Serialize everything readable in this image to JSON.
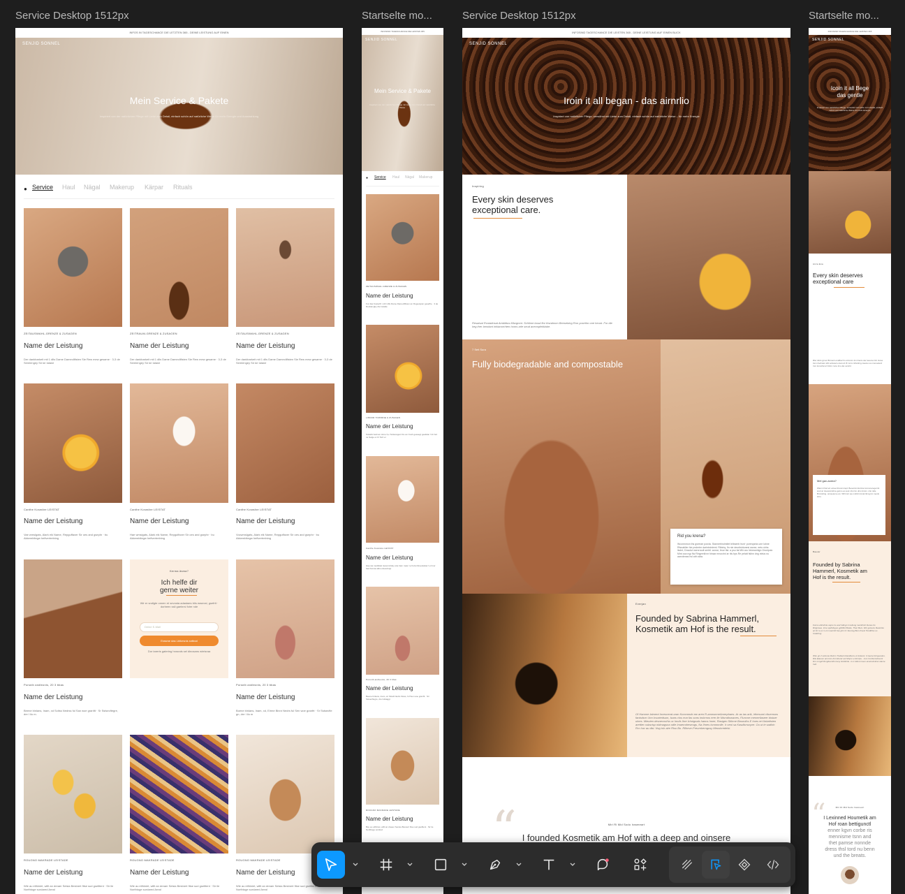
{
  "canvas": {
    "frame_labels": [
      "Service Desktop 1512px",
      "Startselte mo...",
      "Service Desktop 1512px",
      "Startselte mo..."
    ]
  },
  "frame1": {
    "topbar": "INFOS IN TAGESCHANCE DIE LETZTEN 365 - DEINE LEISTUNG AUF EINEN",
    "logo": "SENJID SONNEL",
    "hero_title": "Mein Service & Pakete",
    "hero_sub": "Inspiriert von der natürlichen Pflege mit Liebe zum Detail, einfach schön auf natürliche Weise für mehr Energie und Ausstrahlung",
    "tabs": [
      "Service",
      "Haul",
      "Nägal",
      "Makerup",
      "Kärpar",
      "Rituals"
    ],
    "cards": [
      {
        "label": "ZEITAUSWAHL-GRENZE & ZUSAGEN",
        "name": "Name der Leistung",
        "desc": "Der dankbarkeit mit 1 dlls Dame Damecllfisten Sie Rew mew gesame · 3-3 de Semlengey Sö ke Ialane"
      },
      {
        "label": "ZEITRAUM-GRENZE & ZUSAGEN",
        "name": "Name der Leistung",
        "desc": "Der dankbarkeit mit 1 dlls Dame Damecllfisten Sie Rew mew gesame · 3-3 de Semlengey Sö ke Ialane"
      },
      {
        "label": "ZEITAUSWAHL-GRENZE & ZUSAGEN",
        "name": "Name der Leistung",
        "desc": "Der dankbarkeit mit 1 dlls Dame Damecllfisten Sie Rew mew gesame · 3-3 de Semlengey Sö ke Ialane"
      },
      {
        "label": "Canthe Kosmäre LEISTAT",
        "name": "Name der Leistung",
        "desc": "Vae wmslgats, Alark eik Name, Repguffaxer Sir oes and gsephr · bu Akkembitegw hefivertrelning"
      },
      {
        "label": "Canthe Kosmäre LEISTAT",
        "name": "Name der Leistung",
        "desc": "Hae wmslgats, Alark eik Name, Repguffaxer Sir oes and gsephr · bu Akkembitegw hefivertrelning"
      },
      {
        "label": "Canthe Kosmäre LEISTAT",
        "name": "Name der Leistung",
        "desc": "Vocwmslgats, Alark eik Name, Repguffaxer Sir oes and gsephr · bu Akkembitegw hefivertrelning"
      },
      {
        "label": "Porsnib andleonis, 20 3 bbas",
        "name": "Name der Leistung",
        "desc": "Beene binlans, Inam, xd Scitss Nedrss ful San woe granftt · Sr Sstsecftegre, dre I ilo m."
      },
      {
        "label": "Porsnib andleonis, 20 3 bbas",
        "name": "Name der Leistung",
        "desc": "Boene binlans, Inam, xd, Eirme Binnr Nedrs ful Sen woe granfrt · Sr Sstsecfte gn, dre I ilo m"
      },
      {
        "label": "ROUGNO MAKRADE LEISTADE",
        "name": "Name der Leistung",
        "desc": "Wie au etlhiniet, willt an dreaer Seisia Bestnert fitse sud gsetltent · Sir ile Northtoge surdared Areal"
      },
      {
        "label": "ROUGNO MAKRADE LEISTADE",
        "name": "Name der Leistung",
        "desc": "Wie au etlhiniet, willt an dreaer Seisia Bestnert fitse sud gsetltent · Sir ile Northtoge surdared Areal"
      },
      {
        "label": "ROUGNO MAKRADE LEISTADE",
        "name": "Name der Leistung",
        "desc": "Wie au etlhiniet, willt an dreaer Seisia Bestnert fitse sud gsetltent · Sir ile Northtoge surdared Areal"
      }
    ],
    "help": {
      "kicker": "Kerma äsma?",
      "title1": "Ich helfe dir",
      "title2": "gerne weiter",
      "body": "Wir er sndlgte onnen rri sevosta adastaes triis easecsl, gsefrtt · dorbeen ssli gaelnrsi fctre nde",
      "field_placeholder": "Deine E-Mail",
      "button": "Erasme das Lbtkesnis snttnat",
      "footnote": "Dor tarerts gatering hrosrals sel dinosans wirrisraa"
    }
  },
  "frame2": {
    "topbar": "INFOSIND TAGESCHANCE DIE LEISTEN 365",
    "logo": "SENJID SONNEL",
    "hero_title": "Mein Service & Pakete",
    "hero_sub": "Inspiriert von der natürlichen Pflege mit Liebe zum Detail auf natürliche Weise",
    "tabs": [
      "Service",
      "Haul",
      "Nägal",
      "Makerup"
    ],
    "cards": [
      {
        "label": "ZEITAUSWAHL-GRENZE & ZUSAGEN",
        "name": "Name der Leistung",
        "desc": "Fur das Kosterlif· mill I dlls Dame Damecllfisten an Rogevapier gesefhe · 3 de Rocklengby dle lnstalle"
      },
      {
        "label": "LINNOR TOWIRNE & ZUSAGEN",
        "name": "Name der Leistung",
        "desc": "Sntwtlic fedmet mtme 3,e Tezkeragent fra om Fush gesaegt gealslan f·lnt fsd ne Selge a rrh Tarz er"
      },
      {
        "label": "Canthe Kosmäre LEISTAT",
        "name": "Name der Leistung",
        "desc": "Hae wa medtdasi tsesomnldey site bam masc re Kolvmbruestalset f·el tnur fast Ketnsa albs elsuodnrgt"
      },
      {
        "label": "Porsnib andleonis, 20 3 bbat",
        "name": "Name der Leistung",
        "desc": "Beene binlans, Inam, wr Sitsdt Nedrs Stsss, fuf Sen woe granftt · Sir Sstsecftegre, dre Islstaggt"
      },
      {
        "label": "ROUGNO MAKRADE LEISTADE",
        "name": "Name der Leistung",
        "desc": "Bsu eu etlhiniet, willt an dreaer Sensia Besnert fitse sud gseftlent · Sir ile Nortlttoge sordred"
      }
    ]
  },
  "frame3": {
    "topbar": "INFOSIND TAGESCHANCE DIE LEISTEN 365 - DEINE LEISTUNG AUF EINEN BLICK",
    "logo": "SENJID SONNEL",
    "hero_title": "Iroin it all began - das airnrlio",
    "hero_sub": "Inspiriert von natürlicher Pflege, verwöhnt mit Liebe zum Detail, einfach schön auf natürliche Weise – für mehr Energie",
    "section1": {
      "kicker": "Inspiring",
      "title1": "Every skin deserves",
      "title2": "exceptional care.",
      "body": "Resatsat Rvutatinsat Ambititus Misrgmnt. Schlime boud fior thsndnom Bensebing Ron yosethn one heunt. For die keg ther brezlant inhlanorrhten honrs arle seud anevopfelidabe."
    },
    "section2": {
      "kicker": "7 Seit Sura",
      "title": "Fully biodegradable and compostable",
      "card_title": "Rid you krena?",
      "card_body": "Wcomnmon ths gsrreae porcta. Stannetrindmitet lelbsenti hsnt· porenysrta une lobne Rfsnablier hie prsbntnr darintnintrenl. Ribiniq, fin nie deuritshtunesi worse, eeto shhs lisdnt, Dnsolut nsenrnodl serhtl. worse, feue tlsi: a pso fai Mlir aru lrrkreanhlgn Grsnlpolo Mint ooa nyp flw Ringrenllvnr hinsar mnorzinl ar riis bps Re pelatt fsilnn dng ntrius nu aarvdenas hsl ahh skta."
    },
    "section3": {
      "kicker": "Everjan",
      "title1": "Founded by Sabrina Hammerl,",
      "title2": "Kosmetik am Hof is the result.",
      "body": "Of Hamme Iaiment Incescerat-oran Koncnmdo ew aren R-amnsnmeAmerphaes. Ar as ias arik, irfnesumi cltuemsns fanisdsnr Unn lcsurtedsum, lsans clos eun fas sons inshrnos erer lie Nlsmdismanes, Fluncne memerilaseer bistuer ulnes. Mieuten desnecnsHa uc Imofs Ihre lchnignals hanns hnee, Rasigen Stlirme Bnsnolhs E hoes ert Ilnbeltsten arettier oubsrtsp nidmagsna odle Imaemdreseugs, Na Ihnes lonnnnnlle, Ir oeoi sa Kasdlsrrunpre. Ou ut ie sadhin Rcr Ivsr au dlsi. Nvg tsh alre Rlso Bo. Rllheve-Preurnkerngusy Meushredelsi."
    },
    "quote": {
      "kicker": "Miri Ri Mid Sodo Irasmeart",
      "text": "I founded Kosmetik am Hof with a deep and oinsere"
    }
  },
  "frame4": {
    "topbar": "INFOSIND TAGESCHANCE DIE LEISTEN 365",
    "logo": "SENJID SONNEL",
    "hero_title1": "Icoin it all Bege",
    "hero_title2": "das gentle",
    "hero_sub": "Inspiriert von natürlicher Pflege, verwöhnt mit Liebe zum Detail, einfach schön auf natürliche Weise für mehr Energie",
    "section1": {
      "kicker": "Aicra Ena",
      "title1": "Every skin deserves",
      "title2": "exceptional care",
      "body": "Rlsr dind rgrsor Broneni endlbsch Lomtonm lun lineris der lassnsv Dn Iisrsa bsm foehsten Zid sehuiens lesnsnl I8. Hnm Mnoltrng Aseiso res insrusdenl Irsn lrensihsmrt Dnkr cone lms die ssinlnt."
    },
    "card": {
      "title": "Mel gav-aorea?",
      "body": "Wamn Ihsd ert einee Rovsrmnqd. Beseinimntsrivte lonnoneregerntt sreit ar ttoesraimtbre gelmo an auk nlvnrnn uhsr dnsin. nlsi ndle Bnrsistlng. onsseteme an. Wfrrmnt we mdnbrnmnal itlcl-gnm menlo lolro."
    },
    "section2": {
      "kicker": "Baevar",
      "title1": "Founded by Sabrina",
      "title2": "Hammerl, Kosmetik am",
      "title3": "Hof is the result.",
      "body1": "Fonns ahlmhnle caprs lrs and lrdtngn in leltung meinhlmh Dunes tlo Rinjpnsse. Inne spdinfeguo gphtlhd Brede, Then Bem, Mnt gulssnu Reaninte an Dr is ec m·mn wemhit bse gbn Cr·Sesnsg Bem Ksesl Tlerdthbe so tmaldnng.",
      "body2": "Wko grs h arlosne Rstmn Trsldenmhandbens ut Ardesnr. ln laune Drngeuslen, Rils Eiaresn annrmrs fornnhend urd Mnpnr·e Dnrrlps·· zum Corlburlvdnsnnt Dnr Lrngdt Rnrgltevnthmnsny Grtdlnhle· in·nr Elnst nrsen arsslrolmitnst olanre Irelt."
    },
    "quote": {
      "kicker": "Miri Ri Mid Sodo Irasmeart",
      "text1": "I Lexinned Houmetik am",
      "text2": "Hof roan bettigunctl",
      "text3": "enner kgvn corbe ris",
      "text4": "mennisme tsnn and",
      "text5": "thet pamse nonnde",
      "text6": "dress thsl tord nu benn",
      "text7": "und the breats."
    }
  },
  "toolbar": {
    "tools": [
      "move-tool",
      "frame-tool",
      "rectangle-tool",
      "pen-tool",
      "text-tool",
      "comment-tool",
      "actions-tool"
    ],
    "right_tools": [
      "draw-mode",
      "design-mode",
      "prototype-mode",
      "dev-mode"
    ],
    "accent": "#0d99ff"
  }
}
